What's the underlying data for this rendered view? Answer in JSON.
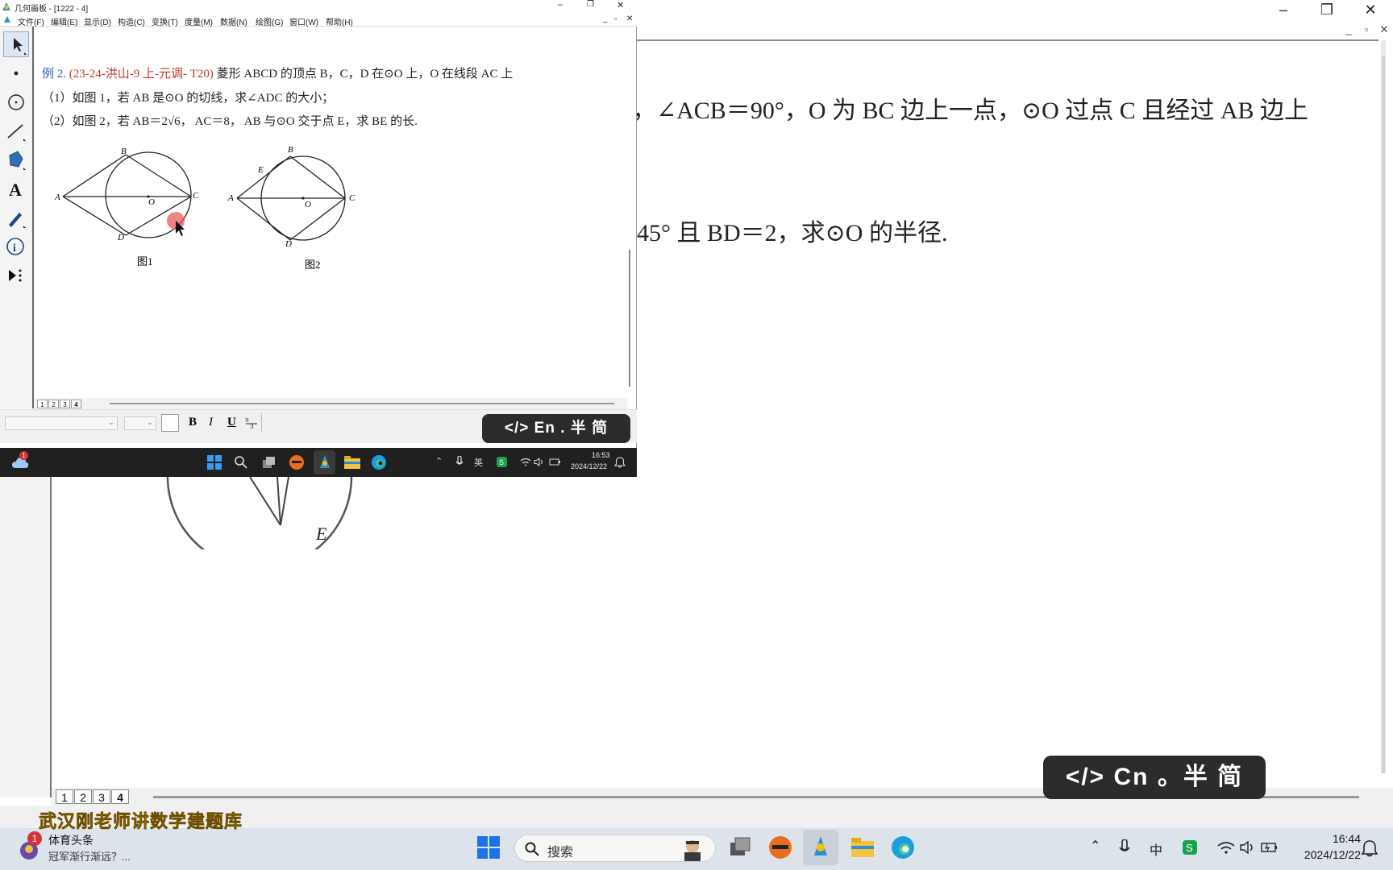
{
  "background_window": {
    "controls": {
      "minimize": "–",
      "restore": "❐",
      "close": "✕"
    },
    "mdi_controls": {
      "minimize": "_",
      "restore": "▫",
      "close": "✕"
    },
    "problem_line1": "，∠ACB＝90°，O 为 BC 边上一点，⊙O 过点 C 且经过 AB 边上",
    "problem_line2": "45° 且 BD＝2，求⊙O 的半径.",
    "figure_label_e": "E",
    "page_tabs": [
      "1",
      "2",
      "3",
      "4"
    ],
    "ime_overlay": "</>  Cn  。半  简"
  },
  "front_window": {
    "title": "几何画板 - [1222 - 4]",
    "controls": {
      "minimize": "–",
      "restore": "❐",
      "close": "✕"
    },
    "menu": [
      "文件(F)",
      "编辑(E)",
      "显示(D)",
      "构造(C)",
      "变换(T)",
      "度量(M)",
      "数据(N)",
      "绘图(G)",
      "窗口(W)",
      "帮助(H)"
    ],
    "tools": [
      "arrow-tool-icon",
      "point-tool-icon",
      "compass-tool-icon",
      "segment-tool-icon",
      "polygon-tool-icon",
      "text-tool-icon",
      "marker-tool-icon",
      "info-tool-icon",
      "custom-tool-icon"
    ],
    "example_prefix": "例 2.",
    "example_source": "(23-24-洪山-9 上-元调- T20)",
    "example_stem": "菱形 ABCD 的顶点 B，C，D 在⊙O 上，O 在线段 AC 上",
    "part1": "（1）如图 1，若 AB 是⊙O 的切线，求∠ADC 的大小；",
    "part2": "（2）如图 2，若 AB＝2√6， AC＝8， AB 与⊙O 交于点 E，求 BE 的长.",
    "fig1": {
      "caption": "图1",
      "labels": [
        "A",
        "B",
        "C",
        "D",
        "O"
      ]
    },
    "fig2": {
      "caption": "图2",
      "labels": [
        "A",
        "B",
        "C",
        "D",
        "E",
        "O"
      ]
    },
    "page_tabs": [
      "1",
      "2",
      "3",
      "4"
    ],
    "text_toolbar": {
      "bold": "B",
      "italic": "I",
      "underline": "U"
    },
    "ime_overlay": "</>  En  .  半   简"
  },
  "front_taskbar": {
    "weather_badge": "1",
    "time": "16:53",
    "date": "2024/12/22",
    "ime": "英"
  },
  "taskbar": {
    "news_badge": "1",
    "news_title": "体育头条",
    "news_sub": "冠军渐行渐远？...",
    "search_placeholder": "搜索",
    "ime": "中",
    "time": "16:44",
    "date": "2024/12/22"
  },
  "watermark": "武汉刚老师讲数学建题库",
  "colors": {
    "taskbar": "#dde3ea",
    "accent_blue": "#0067c0",
    "example_red": "#c0392b",
    "example_blue": "#2a5db0"
  }
}
